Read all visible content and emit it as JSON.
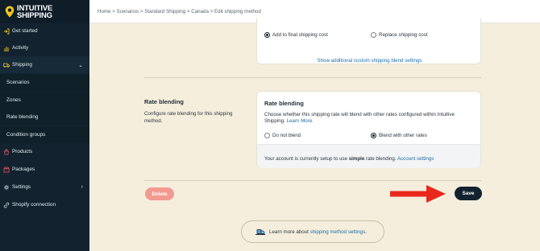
{
  "brand": {
    "line1": "INTUITIVE",
    "line2": "SHIPPING"
  },
  "breadcrumb": {
    "home": "Home",
    "sep": ">",
    "scenarios": "Scenarios",
    "standard": "Standard Shipping",
    "canada": "Canada",
    "current": "Edit shipping method"
  },
  "sidebar": {
    "items": [
      {
        "label": "Get started",
        "icon": "login-icon"
      },
      {
        "label": "Activity",
        "icon": "activity-icon"
      },
      {
        "label": "Shipping",
        "icon": "truck-icon"
      },
      {
        "label": "Scenarios"
      },
      {
        "label": "Zones"
      },
      {
        "label": "Rate blending"
      },
      {
        "label": "Condition groups"
      },
      {
        "label": "Products",
        "icon": "products-icon"
      },
      {
        "label": "Packages",
        "icon": "packages-icon"
      },
      {
        "label": "Settings",
        "icon": "gear-icon"
      },
      {
        "label": "Shopify connection",
        "icon": "link-icon"
      }
    ]
  },
  "cost_card": {
    "option_add": "Add to final shipping cost",
    "option_replace": "Replace shipping cost",
    "show_link": "Show additional custom shipping blend settings"
  },
  "rate_blending": {
    "section_title": "Rate blending",
    "section_desc": "Configure rate blending for this shipping method.",
    "card_title": "Rate blending",
    "card_desc": "Choose whether this shipping rate will blend with other rates configured within Intuitive Shipping.",
    "learn_more": "Learn More.",
    "option_no": "Do not blend",
    "option_yes": "Blend with other rates",
    "footer_pre": "Your account is currently setup to use",
    "footer_bold": "simple",
    "footer_post": "rate blending.",
    "footer_link": "Account settings"
  },
  "actions": {
    "delete": "Delete",
    "save": "Save"
  },
  "help": {
    "pre": "Learn more about",
    "link": "shipping method settings",
    "post": "."
  },
  "colors": {
    "sidebar": "#12232f",
    "accent_link": "#1d6fa5",
    "delete": "#f29a8f",
    "save": "#12232f",
    "arrow": "#e8281c",
    "page": "#f5eedd"
  }
}
